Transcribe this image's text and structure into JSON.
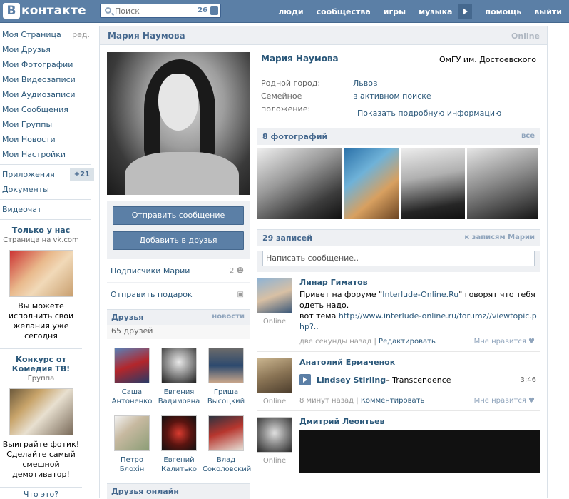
{
  "topbar": {
    "logo_letter": "В",
    "logo_text": "контакте",
    "search_placeholder": "Поиск",
    "search_count": "26",
    "nav": [
      "люди",
      "сообщества",
      "игры",
      "музыка",
      "помощь",
      "выйти"
    ]
  },
  "leftmenu": {
    "items": [
      {
        "label": "Моя Страница",
        "extra": "ред."
      },
      {
        "label": "Мои Друзья"
      },
      {
        "label": "Мои Фотографии"
      },
      {
        "label": "Мои Видеозаписи"
      },
      {
        "label": "Мои Аудиозаписи"
      },
      {
        "label": "Мои Сообщения"
      },
      {
        "label": "Мои Группы"
      },
      {
        "label": "Мои Новости"
      },
      {
        "label": "Мои Настройки"
      }
    ],
    "apps": {
      "label": "Приложения",
      "badge": "+21"
    },
    "docs": "Документы",
    "videochat": "Видеочат"
  },
  "promos": [
    {
      "title": "Только у нас",
      "sub": "Страница на vk.com",
      "desc": "Вы можете исполнить свои желания уже сегодня"
    },
    {
      "title": "Конкурс от Комедия ТВ!",
      "sub": "Группа",
      "desc": "Выиграйте фотик! Сделайте самый смешной демотиватор!"
    }
  ],
  "bottom_link": "Что это?",
  "profile": {
    "header_name": "Мария Наумова",
    "online": "Online",
    "name": "Мария Наумова",
    "university": "ОмГУ им. Достоевского",
    "info": [
      {
        "key": "Родной город:",
        "value": "Львов"
      },
      {
        "key": "Семейное положение:",
        "value": "в активном поиске"
      }
    ],
    "more": "Показать подробную информацию"
  },
  "actions": {
    "send_message": "Отправить сообщение",
    "add_friend": "Добавить в друзья",
    "subscribers": "Подписчики Марии",
    "subscribers_count": "2",
    "gift": "Отправить подарок"
  },
  "friends": {
    "title": "Друзья",
    "news": "новости",
    "count": "65 друзей",
    "list": [
      {
        "first": "Саша",
        "last": "Антоненко"
      },
      {
        "first": "Евгения",
        "last": "Вадимовна"
      },
      {
        "first": "Гриша",
        "last": "Высоцкий"
      },
      {
        "first": "Петро",
        "last": "Блохін"
      },
      {
        "first": "Евгений",
        "last": "Калитько"
      },
      {
        "first": "Влад",
        "last": "Соколовский"
      }
    ],
    "online_title": "Друзья онлайн"
  },
  "photos": {
    "title": "8 фотографий",
    "all": "все"
  },
  "wall": {
    "count": "29 записей",
    "to_posts": "к записям Марии",
    "input_placeholder": "Написать сообщение..",
    "posts": [
      {
        "author": "Линар Гиматов",
        "online": "Online",
        "text_pre": "Привет на форуме \"",
        "text_link": "Interlude-Online.Ru",
        "text_mid": "\" говорят что тебя одеть надо.",
        "text_line2": "вот тема ",
        "url": "http://www.interlude-online.ru/forumz//viewtopic.php?..",
        "time": "две секунды назад",
        "action": "Редактировать",
        "like": "Мне нравится"
      },
      {
        "author": "Анатолий Ермаченок",
        "online": "Online",
        "artist": "Lindsey Stirling",
        "track": " – Transcendence",
        "duration": "3:46",
        "time": "8 минут назад",
        "action": "Комментировать",
        "like": "Мне нравится"
      },
      {
        "author": "Дмитрий Леонтьев",
        "online": "Online"
      }
    ]
  },
  "colors": {
    "brand": "#5b7fa6",
    "link": "#2b587a",
    "panel": "#eef0f3"
  }
}
